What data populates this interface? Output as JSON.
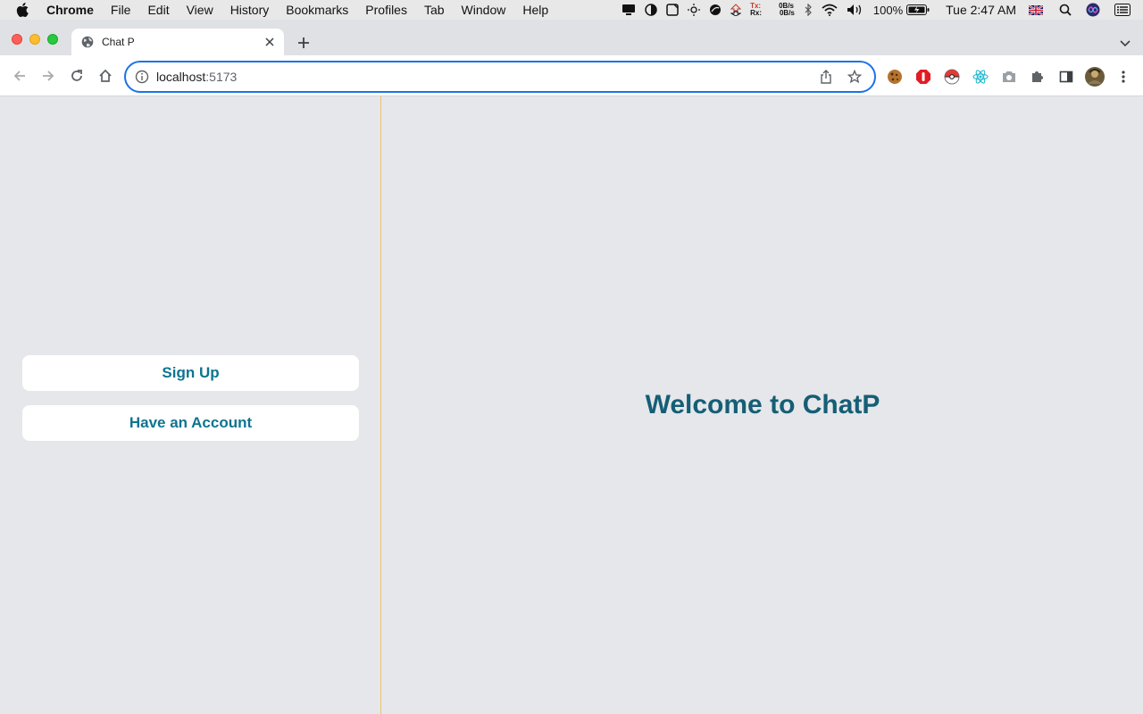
{
  "menubar": {
    "app_name": "Chrome",
    "items": [
      "File",
      "Edit",
      "View",
      "History",
      "Bookmarks",
      "Profiles",
      "Tab",
      "Window",
      "Help"
    ],
    "net_tx_label": "Tx:",
    "net_rx_label": "Rx:",
    "net_tx_rate": "0B/s",
    "net_rx_rate": "0B/s",
    "battery": "100%",
    "clock": "Tue 2:47 AM"
  },
  "browser": {
    "tab_title": "Chat P",
    "url_host": "localhost",
    "url_port": ":5173"
  },
  "page": {
    "signup_label": "Sign Up",
    "login_label": "Have an Account",
    "welcome_text": "Welcome to ChatP"
  },
  "colors": {
    "accent_text": "#0e7490",
    "heading": "#155e75",
    "divider": "#e9c46a",
    "background": "#e5e7eb"
  }
}
